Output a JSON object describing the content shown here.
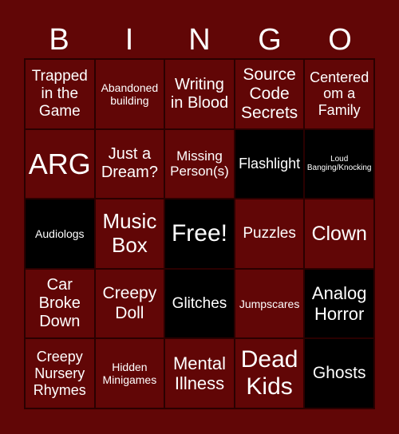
{
  "header": {
    "letters": [
      "B",
      "I",
      "N",
      "G",
      "O"
    ]
  },
  "colors": {
    "background": "#610606",
    "marked": "#000000",
    "text": "#ffffff"
  },
  "cells": [
    {
      "text": "Trapped in the Game",
      "marked": false,
      "size": "md"
    },
    {
      "text": "Abandoned building",
      "marked": false,
      "size": "sm"
    },
    {
      "text": "Writing in Blood",
      "marked": false,
      "size": "md"
    },
    {
      "text": "Source Code Secrets",
      "marked": false,
      "size": "md"
    },
    {
      "text": "Centered om a Family",
      "marked": false,
      "size": "md"
    },
    {
      "text": "ARG",
      "marked": false,
      "size": "xxl"
    },
    {
      "text": "Just a Dream?",
      "marked": false,
      "size": "md"
    },
    {
      "text": "Missing Person(s)",
      "marked": false,
      "size": "md"
    },
    {
      "text": "Flashlight",
      "marked": true,
      "size": "md"
    },
    {
      "text": "Loud Banging/Knocking",
      "marked": true,
      "size": "xs"
    },
    {
      "text": "Audiologs",
      "marked": true,
      "size": "sm"
    },
    {
      "text": "Music Box",
      "marked": false,
      "size": "lg"
    },
    {
      "text": "Free!",
      "marked": true,
      "size": "xl"
    },
    {
      "text": "Puzzles",
      "marked": false,
      "size": "md"
    },
    {
      "text": "Clown",
      "marked": false,
      "size": "lg"
    },
    {
      "text": "Car Broke Down",
      "marked": false,
      "size": "md"
    },
    {
      "text": "Creepy Doll",
      "marked": false,
      "size": "md"
    },
    {
      "text": "Glitches",
      "marked": true,
      "size": "md"
    },
    {
      "text": "Jumpscares",
      "marked": false,
      "size": "sm"
    },
    {
      "text": "Analog Horror",
      "marked": true,
      "size": "md"
    },
    {
      "text": "Creepy Nursery Rhymes",
      "marked": false,
      "size": "md"
    },
    {
      "text": "Hidden Minigames",
      "marked": false,
      "size": "sm"
    },
    {
      "text": "Mental Illness",
      "marked": false,
      "size": "md"
    },
    {
      "text": "Dead Kids",
      "marked": false,
      "size": "xl"
    },
    {
      "text": "Ghosts",
      "marked": true,
      "size": "md"
    }
  ]
}
